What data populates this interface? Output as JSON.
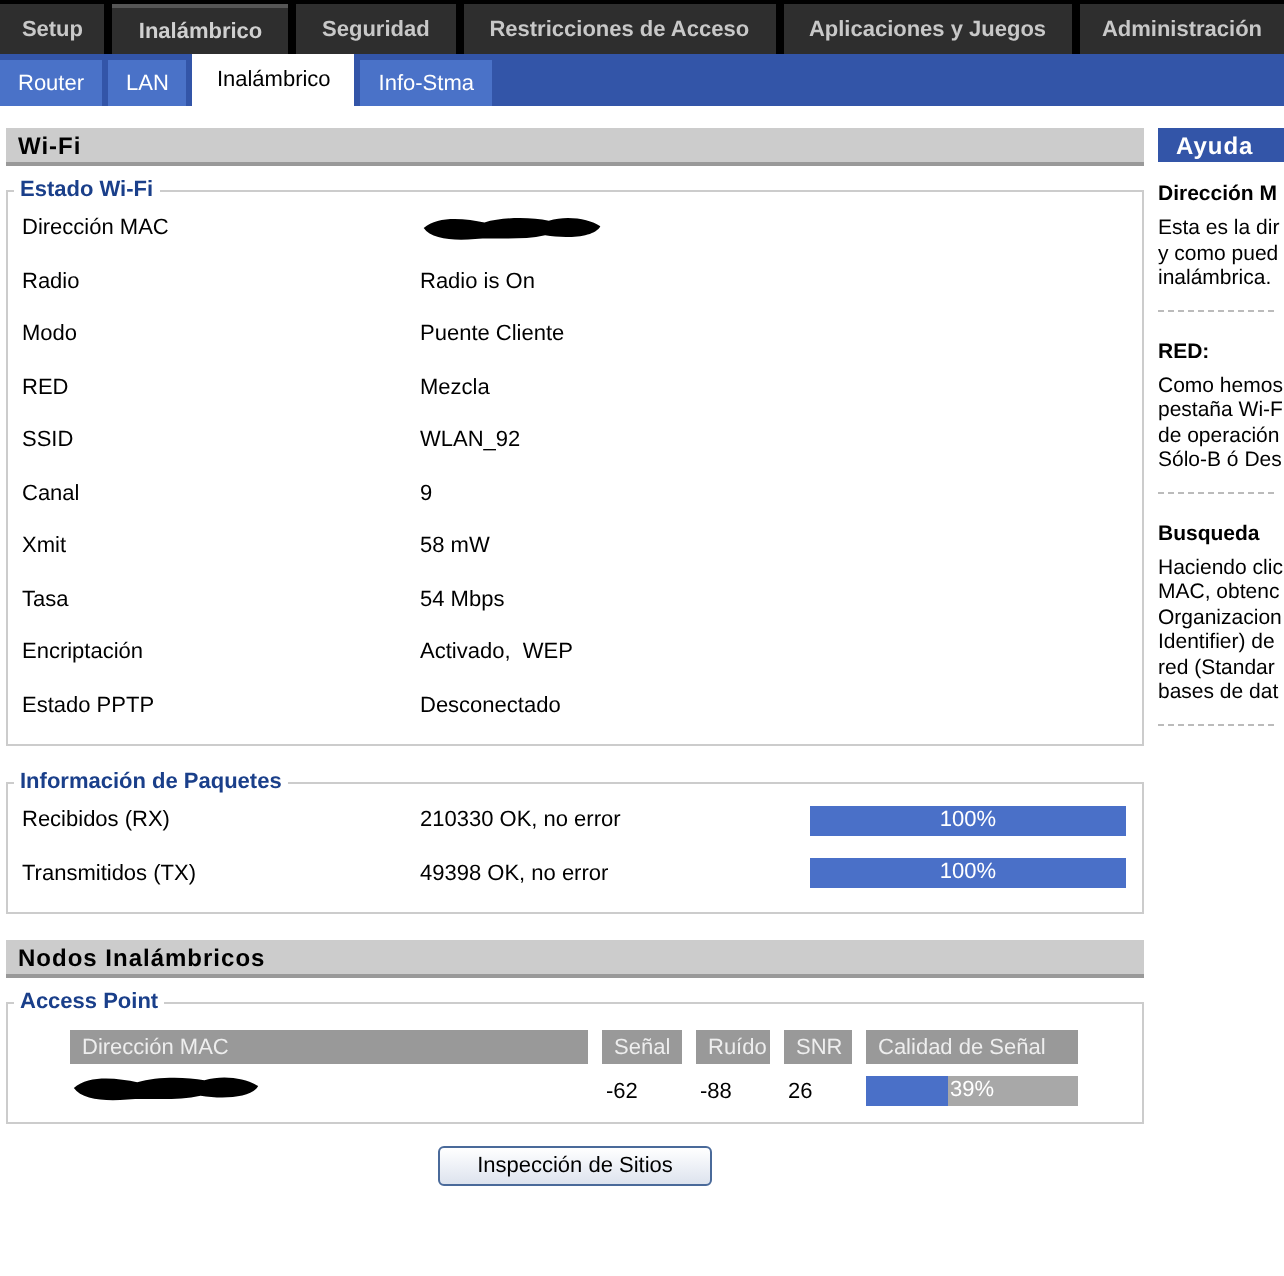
{
  "main_tabs": [
    {
      "label": "Setup",
      "selected": false
    },
    {
      "label": "Inalámbrico",
      "selected": true
    },
    {
      "label": "Seguridad",
      "selected": false
    },
    {
      "label": "Restricciones de Acceso",
      "selected": false
    },
    {
      "label": "Aplicaciones y Juegos",
      "selected": false
    },
    {
      "label": "Administración",
      "selected": false
    }
  ],
  "sub_tabs": [
    {
      "label": "Router",
      "selected": false
    },
    {
      "label": "LAN",
      "selected": false
    },
    {
      "label": "Inalámbrico",
      "selected": true
    },
    {
      "label": "Info-Stma",
      "selected": false
    }
  ],
  "wifi": {
    "title": "Wi-Fi",
    "status": {
      "legend": "Estado Wi-Fi",
      "rows": [
        {
          "label": "Dirección MAC",
          "kind": "redacted"
        },
        {
          "label": "Radio",
          "value": "Radio is On",
          "kind": "text"
        },
        {
          "label": "Modo",
          "value": "Puente Cliente",
          "kind": "text"
        },
        {
          "label": "RED",
          "value": "Mezcla",
          "kind": "text"
        },
        {
          "label": "SSID",
          "value": "WLAN_92",
          "kind": "text"
        },
        {
          "label": "Canal",
          "value": "9",
          "kind": "text"
        },
        {
          "label": "Xmit",
          "value": "58 mW",
          "kind": "text"
        },
        {
          "label": "Tasa",
          "value": "54 Mbps",
          "kind": "text"
        },
        {
          "label": "Encriptación",
          "value": "Activado,  WEP",
          "kind": "text"
        },
        {
          "label": "Estado PPTP",
          "value": "Desconectado",
          "kind": "text"
        }
      ]
    },
    "packets": {
      "legend": "Información de Paquetes",
      "rows": [
        {
          "label": "Recibidos (RX)",
          "value": "210330 OK, no error",
          "level": 1,
          "reading": "100%"
        },
        {
          "label": "Transmitidos (TX)",
          "value": "49398 OK, no error",
          "level": 1,
          "reading": "100%"
        }
      ]
    }
  },
  "nodes": {
    "title": "Nodos Inalámbricos",
    "legend": "Access Point",
    "columns": [
      "Dirección MAC",
      "Señal",
      "Ruído",
      "SNR",
      "Calidad de Señal"
    ],
    "rows": [
      {
        "signal": "-62",
        "noise": "-88",
        "snr": "26",
        "level": 0.39,
        "reading": "39%"
      }
    ]
  },
  "site_survey_button": "Inspección de Sitios",
  "help": {
    "title": "Ayuda",
    "sections": [
      {
        "heading": "Dirección M",
        "lines": [
          "Esta es la dir",
          "y como pued",
          "inalámbrica."
        ]
      },
      {
        "heading": "RED:",
        "lines": [
          "Como hemos",
          "pestaña Wi-F",
          "de operación",
          "Sólo-B ó Des"
        ]
      },
      {
        "heading": "Busqueda",
        "lines": [
          "Haciendo clic",
          "MAC, obtenc",
          "Organizacion",
          "Identifier) de",
          "red (Standar",
          "bases de dat"
        ]
      }
    ]
  }
}
